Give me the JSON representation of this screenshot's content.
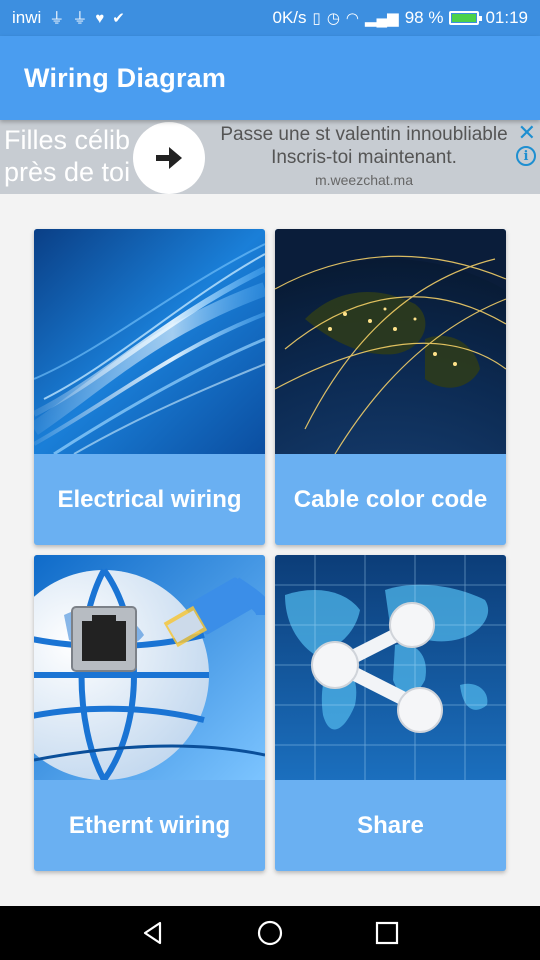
{
  "status_bar": {
    "carrier": "inwi",
    "net_speed": "0K/s",
    "battery_pct": "98 %",
    "battery_level": 0.98,
    "time": "01:19"
  },
  "app_bar": {
    "title": "Wiring Diagram"
  },
  "ad": {
    "left_text_line1": "Filles célib",
    "left_text_line2": "près de toi",
    "headline": "Passe une st valentin innoubliable",
    "cta": "Inscris-toi maintenant.",
    "url": "m.weezchat.ma",
    "close_icon": "close-icon",
    "info_icon": "info-icon"
  },
  "menu": {
    "items": [
      {
        "label": "Electrical wiring",
        "image": "electrical-fiber-image"
      },
      {
        "label": "Cable color code",
        "image": "globe-network-image"
      },
      {
        "label": "Ethernt wiring",
        "image": "ethernet-globe-image"
      },
      {
        "label": "Share",
        "image": "share-world-map-image"
      }
    ]
  },
  "nav_bar": {
    "icons": [
      "back-icon",
      "home-icon",
      "recents-icon"
    ]
  },
  "colors": {
    "status_bar": "#3d8fe0",
    "app_bar": "#4a9df0",
    "card": "#6ab0f2"
  }
}
